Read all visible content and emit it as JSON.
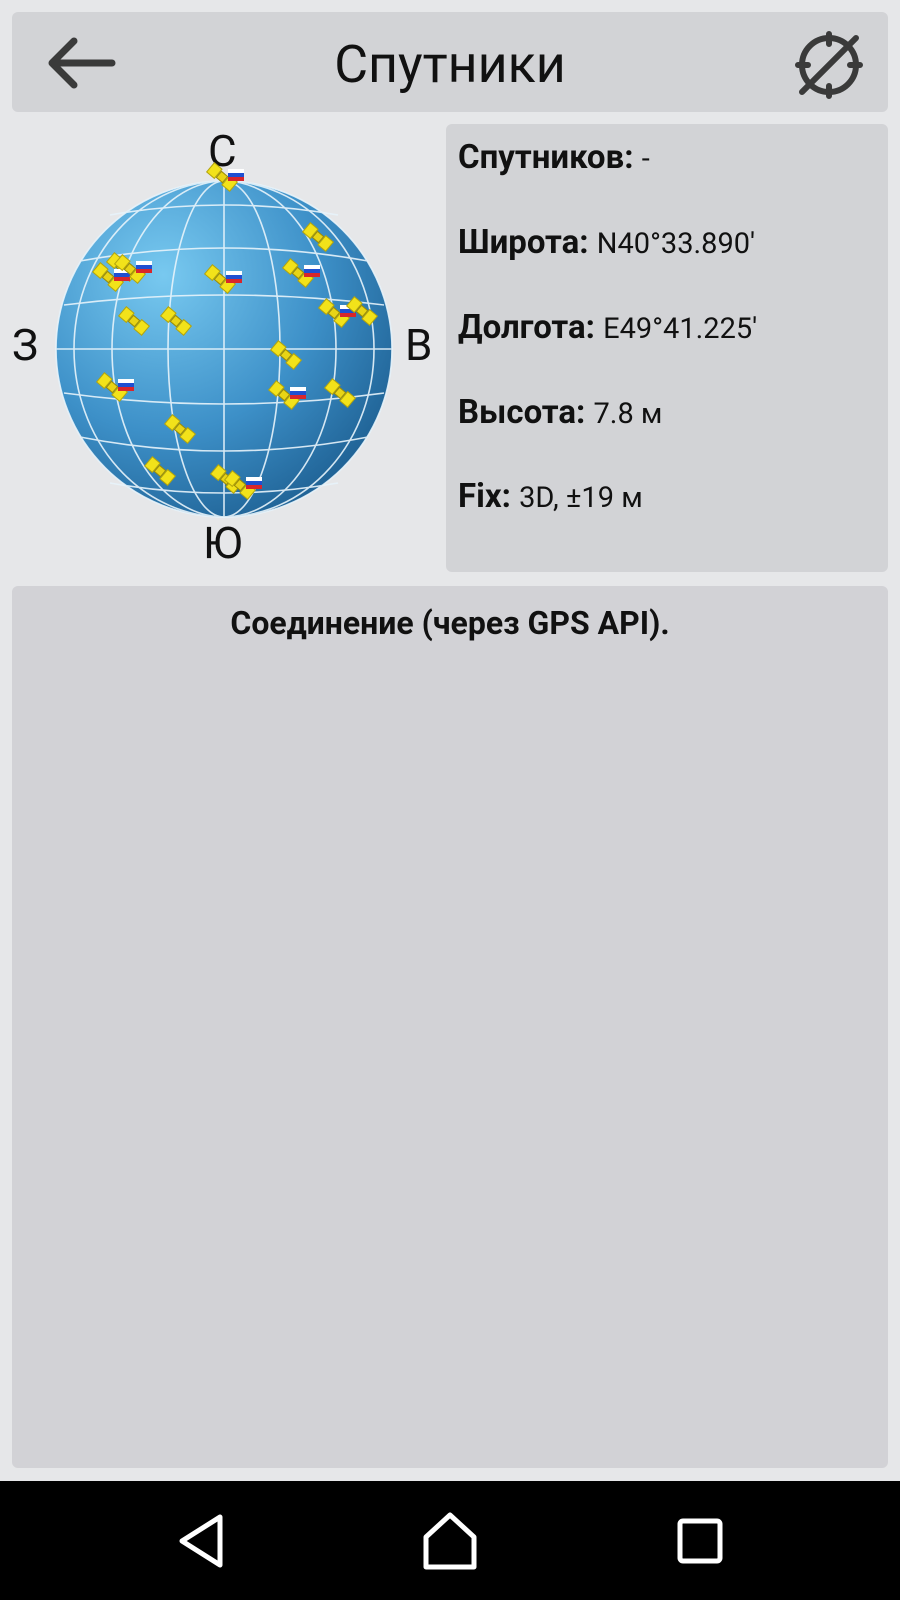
{
  "header": {
    "title": "Спутники",
    "back_icon": "arrow-left-icon",
    "gps_icon": "gps-off-icon"
  },
  "compass": {
    "north": "С",
    "south": "Ю",
    "west": "З",
    "east": "В"
  },
  "info": {
    "satellites_label": "Спутников:",
    "satellites_value": "-",
    "latitude_label": "Широта:",
    "latitude_value": "N40°33.890′",
    "longitude_label": "Долгота:",
    "longitude_value": "E49°41.225′",
    "altitude_label": "Высота:",
    "altitude_value": "7.8 м",
    "fix_label": "Fix:",
    "fix_value": "3D, ±19 м"
  },
  "status": {
    "text": "Соединение (через GPS API)."
  },
  "navbar": {
    "back_icon": "triangle-back-icon",
    "home_icon": "home-icon",
    "recents_icon": "square-recents-icon"
  },
  "colors": {
    "globe_light": "#6fc3ee",
    "globe_dark": "#1b5c8e",
    "satellite": "#f2e21a",
    "panel": "#d2d3d6",
    "background": "#e6e7e9"
  }
}
